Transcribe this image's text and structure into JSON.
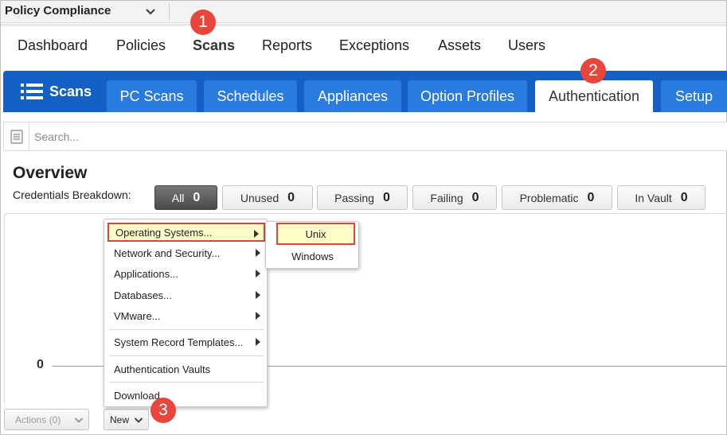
{
  "app": {
    "title": "Policy Compliance"
  },
  "main_nav": {
    "items": [
      {
        "label": "Dashboard"
      },
      {
        "label": "Policies"
      },
      {
        "label": "Scans"
      },
      {
        "label": "Reports"
      },
      {
        "label": "Exceptions"
      },
      {
        "label": "Assets"
      },
      {
        "label": "Users"
      }
    ],
    "active": "Scans"
  },
  "steps": [
    "1",
    "2",
    "3"
  ],
  "tab_bar": {
    "section_label": "Scans",
    "tabs": [
      {
        "label": "PC Scans"
      },
      {
        "label": "Schedules"
      },
      {
        "label": "Appliances"
      },
      {
        "label": "Option Profiles"
      },
      {
        "label": "Authentication"
      },
      {
        "label": "Setup"
      }
    ],
    "active": "Authentication"
  },
  "search": {
    "placeholder": "Search..."
  },
  "overview": {
    "title": "Overview",
    "breakdown_label": "Credentials Breakdown:",
    "filters": [
      {
        "label": "All",
        "count": "0"
      },
      {
        "label": "Unused",
        "count": "0"
      },
      {
        "label": "Passing",
        "count": "0"
      },
      {
        "label": "Failing",
        "count": "0"
      },
      {
        "label": "Problematic",
        "count": "0"
      },
      {
        "label": "In Vault",
        "count": "0"
      }
    ],
    "active_filter": "All"
  },
  "chart": {
    "axis_zero_label": "0"
  },
  "bottom": {
    "actions_label": "Actions (0)",
    "new_label": "New"
  },
  "new_menu": {
    "items": [
      {
        "label": "Operating Systems...",
        "has_submenu": true
      },
      {
        "label": "Network and Security...",
        "has_submenu": true
      },
      {
        "label": "Applications...",
        "has_submenu": true
      },
      {
        "label": "Databases...",
        "has_submenu": true
      },
      {
        "label": "VMware...",
        "has_submenu": true
      },
      {
        "label": "System Record Templates...",
        "has_submenu": true
      },
      {
        "label": "Authentication Vaults",
        "has_submenu": false
      },
      {
        "label": "Download",
        "has_submenu": false
      }
    ],
    "highlighted": "Operating Systems..."
  },
  "os_submenu": {
    "items": [
      {
        "label": "Unix"
      },
      {
        "label": "Windows"
      }
    ],
    "highlighted": "Unix"
  },
  "colors": {
    "tab_bar": "#1560c5",
    "tab": "#2a7be0",
    "step_badge": "#e8453c",
    "highlight_border": "#e0443b",
    "highlight_fill": "#fffdc8"
  },
  "icons": {
    "app_switcher": "chevron-down-icon",
    "section": "list-icon",
    "search_toggle": "document-list-icon",
    "submenu_arrow": "caret-right-icon"
  }
}
